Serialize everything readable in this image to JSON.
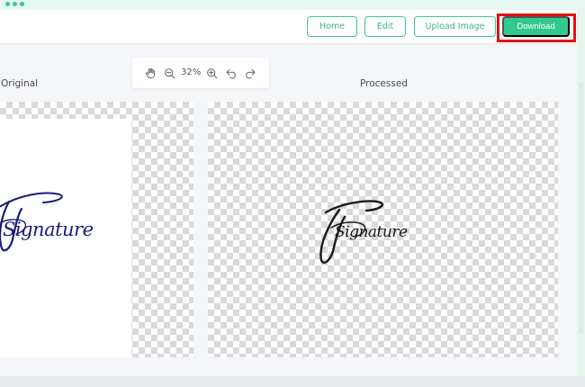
{
  "header": {
    "nav": {
      "home": "Home",
      "edit": "Edit",
      "upload": "Upload Image",
      "download": "Download"
    }
  },
  "toolbar": {
    "zoom": "32%",
    "tools": [
      "hand-icon",
      "zoom-out-icon",
      "zoom-in-icon",
      "undo-icon",
      "redo-icon"
    ]
  },
  "panels": {
    "original_label": "Original",
    "processed_label": "Processed"
  },
  "images": {
    "original": "Signature",
    "processed": "Signature"
  },
  "colors": {
    "accent": "#33c98e",
    "highlight": "#e31212",
    "signature_original": "#1d1a7a",
    "signature_processed": "#1a1a1a"
  }
}
